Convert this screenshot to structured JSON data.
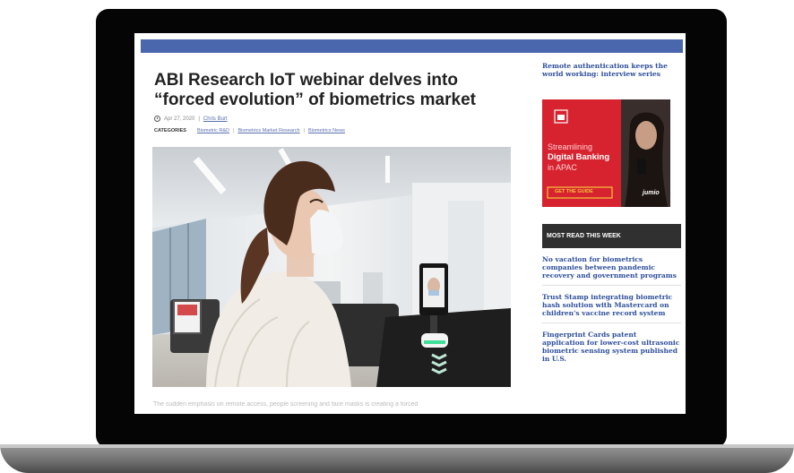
{
  "article": {
    "title": "ABI Research IoT webinar delves into “forced evolution” of biometrics market",
    "date": "Apr 27, 2020",
    "date_sep": "|",
    "author": "Chris Burt",
    "categories_label": "CATEGORIES",
    "categories": [
      "Biometric R&D",
      "Biometrics Market Research",
      "Biometrics News"
    ],
    "excerpt": "The sudden emphasis on remote access, people screening and face masks is creating a forced"
  },
  "sidebar": {
    "top_link": "Remote authentication keeps the world working: interview series",
    "ad": {
      "line1": "Streamlining",
      "line2": "Digital Banking",
      "line3": "in APAC",
      "cta": "GET THE GUIDE",
      "brand": "jumio"
    },
    "most_read_header": "MOST READ THIS WEEK",
    "most_read": [
      "No vacation for biometrics companies between pandemic recovery and government programs",
      "Trust Stamp integrating biometric hash solution with Mastercard on children's vaccine record system",
      "Fingerprint Cards patent application for lower-cost ultrasonic biometric sensing system published in U.S."
    ]
  },
  "colors": {
    "top_bar": "#4a66ad",
    "link": "#2f4f9a",
    "ad_red": "#d7232f",
    "header_dark": "#303030"
  }
}
